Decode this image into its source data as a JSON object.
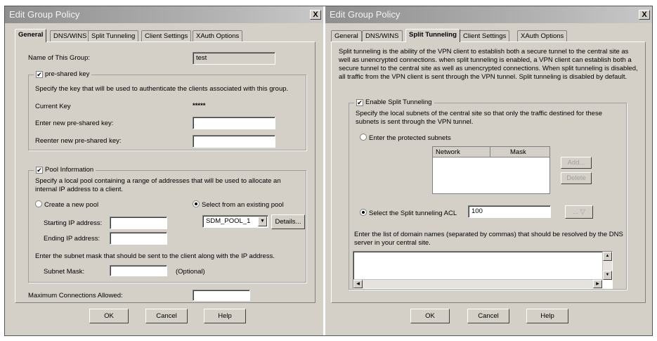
{
  "left": {
    "title": "Edit Group Policy",
    "close": "X",
    "tabs": [
      "General",
      "DNS/WINS",
      "Split Tunneling",
      "Client Settings",
      "XAuth Options"
    ],
    "group_name_label": "Name of This Group:",
    "group_name_value": "test",
    "psk_checkbox": "pre-shared key",
    "psk_description": "Specify the key that will be used to authenticate the clients associated with this group.",
    "current_key_label": "Current Key",
    "current_key_value": "*****",
    "new_key_label": "Enter new pre-shared key:",
    "reenter_key_label": "Reenter new pre-shared key:",
    "pool_checkbox": "Pool Information",
    "pool_description": "Specify a local pool containing a range of addresses that will be used to allocate an internal IP address to a client.",
    "create_pool_label": "Create a new pool",
    "select_pool_label": "Select from an existing pool",
    "start_ip_label": "Starting IP address:",
    "end_ip_label": "Ending IP address:",
    "pool_select_value": "SDM_POOL_1",
    "details_button": "Details...",
    "subnet_description": "Enter the subnet mask that should be sent to the client along with the IP address.",
    "subnet_mask_label": "Subnet Mask:",
    "optional_label": "(Optional)",
    "max_conn_label": "Maximum Connections Allowed:",
    "ok": "OK",
    "cancel": "Cancel",
    "help": "Help"
  },
  "right": {
    "title": "Edit Group Policy",
    "close": "X",
    "tabs": [
      "General",
      "DNS/WINS",
      "Split Tunneling",
      "Client Settings",
      "XAuth Options"
    ],
    "intro": "Split tunneling is the ability of the VPN client to establish both a secure tunnel to the central site as well as unencrypted connections. when split tunneling is enabled, a VPN client can establish both a secure tunnel to the central site as well as unencrypted connections. When split tunneling is disabled, all traffic from the VPN client is sent through the VPN tunnel. Split tunneling is disabled by default.",
    "enable_checkbox": "Enable Split Tunneling",
    "subnets_description": "Specify the local subnets of the central site so that only the traffic destined for these subnets is sent through the VPN tunnel.",
    "protected_subnets_label": "Enter the protected subnets",
    "table_headers": [
      "Network",
      "Mask"
    ],
    "add_button": "Add...",
    "delete_button": "Delete",
    "acl_label": "Select the Split tunneling ACL",
    "acl_value": "100",
    "acl_browse": "...",
    "domains_description": "Enter the list of domain names (separated by commas) that should be resolved by the DNS server in your central site.",
    "ok": "OK",
    "cancel": "Cancel",
    "help": "Help"
  }
}
